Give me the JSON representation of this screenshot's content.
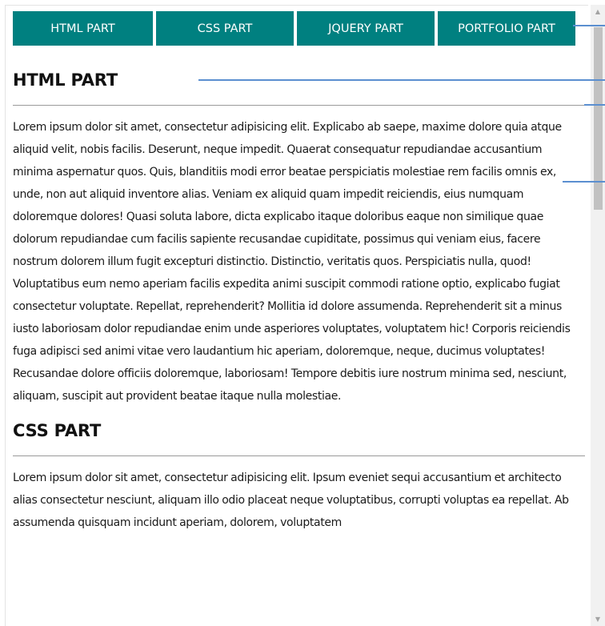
{
  "nav": {
    "items": [
      {
        "label": "HTML PART"
      },
      {
        "label": "CSS PART"
      },
      {
        "label": "JQUERY PART"
      },
      {
        "label": "PORTFOLIO PART"
      }
    ]
  },
  "sections": [
    {
      "title": "HTML PART",
      "text": "Lorem ipsum dolor sit amet, consectetur adipisicing elit. Explicabo ab saepe, maxime dolore quia atque aliquid velit, nobis facilis. Deserunt, neque impedit. Quaerat consequatur repudiandae accusantium minima aspernatur quos. Quis, blanditiis modi error beatae perspiciatis molestiae rem facilis omnis ex, unde, non aut aliquid inventore alias. Veniam ex aliquid quam impedit reiciendis, eius numquam doloremque dolores! Quasi soluta labore, dicta explicabo itaque doloribus eaque non similique quae dolorum repudiandae cum facilis sapiente recusandae cupiditate, possimus qui veniam eius, facere nostrum dolorem illum fugit excepturi distinctio. Distinctio, veritatis quos. Perspiciatis nulla, quod! Voluptatibus eum nemo aperiam facilis expedita animi suscipit commodi ratione optio, explicabo fugiat consectetur voluptate. Repellat, reprehenderit? Mollitia id dolore assumenda. Reprehenderit sit a minus iusto laboriosam dolor repudiandae enim unde asperiores voluptates, voluptatem hic! Corporis reiciendis fuga adipisci sed animi vitae vero laudantium hic aperiam, doloremque, neque, ducimus voluptates! Recusandae dolore officiis doloremque, laboriosam! Tempore debitis iure nostrum minima sed, nesciunt, aliquam, suscipit aut provident beatae itaque nulla molestiae."
    },
    {
      "title": "CSS PART",
      "text": "Lorem ipsum dolor sit amet, consectetur adipisicing elit. Ipsum eveniet sequi accusantium et architecto alias consectetur nesciunt, aliquam illo odio placeat neque voluptatibus, corrupti voluptas ea repellat. Ab assumenda quisquam incidunt aperiam, dolorem, voluptatem"
    }
  ],
  "colors": {
    "nav_background": "#008080",
    "nav_text": "#ffffff",
    "annotation_line": "#5b8fd0"
  },
  "scrollbar": {
    "up_icon": "triangle-up",
    "down_icon": "triangle-down"
  }
}
